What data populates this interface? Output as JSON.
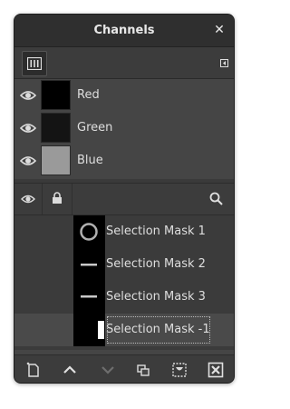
{
  "dialog": {
    "title": "Channels",
    "close_glyph": "✕"
  },
  "tabs": [
    {
      "icon": "channels-tab-icon"
    }
  ],
  "channels": [
    {
      "label": "Red",
      "visible": true,
      "thumb_color": "#000000"
    },
    {
      "label": "Green",
      "visible": true,
      "thumb_color": "#141414"
    },
    {
      "label": "Blue",
      "visible": true,
      "thumb_color": "#9a9a9a"
    }
  ],
  "mask_header": {
    "icons": [
      "eye-icon",
      "lock-icon",
      "search-icon"
    ]
  },
  "masks": [
    {
      "label": "Selection Mask 1",
      "thumb": "ring",
      "selected": false
    },
    {
      "label": "Selection Mask 2",
      "thumb": "line",
      "selected": false
    },
    {
      "label": "Selection Mask 3",
      "thumb": "line",
      "selected": false
    },
    {
      "label": "Selection Mask -1",
      "thumb": "bar",
      "selected": true
    }
  ],
  "bottom_toolbar": {
    "buttons": [
      "new-channel-icon",
      "raise-icon",
      "lower-icon",
      "duplicate-icon",
      "to-selection-icon",
      "delete-icon"
    ]
  },
  "colors": {
    "dialog_bg": "#454545",
    "titlebar_bg": "#2f2f2f",
    "text": "#dedede"
  }
}
